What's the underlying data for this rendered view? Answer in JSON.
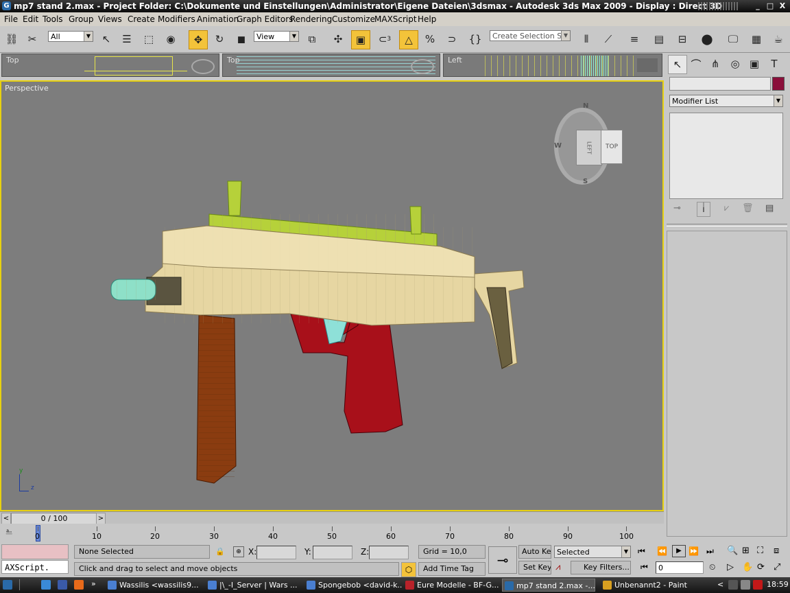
{
  "title_bar": {
    "text": "mp7 stand 2.max      - Project Folder: C:\\Dokumente und Einstellungen\\Administrator\\Eigene Dateien\\3dsmax      - Autodesk 3ds Max  2009         - Display : Direct 3D",
    "minimize": "_",
    "maximize": "□",
    "close": "X"
  },
  "menu": [
    "File",
    "Edit",
    "Tools",
    "Group",
    "Views",
    "Create",
    "Modifiers",
    "Animation",
    "Graph Editors",
    "Rendering",
    "Customize",
    "MAXScript",
    "Help"
  ],
  "toolbar": {
    "selection_filter": "All",
    "ref_coord": "View",
    "snap_count": "3",
    "named_selection_placeholder": "Create Selection Set"
  },
  "viewports": {
    "top_left_label": "Top",
    "top_mid_label": "Top",
    "left_label": "Left",
    "perspective_label": "Perspective",
    "viewcube": {
      "face_left": "LEFT",
      "face_top": "TOP",
      "compass_n": "N",
      "compass_s": "S",
      "compass_w": "W"
    },
    "axis_y": "y",
    "axis_z": "z"
  },
  "command_panel": {
    "object_name": "",
    "modifier_list": "Modifier List",
    "color_swatch": "#8a0f3a"
  },
  "timeline": {
    "frame_display": "0 / 100",
    "prev": "<",
    "next": ">",
    "ticks": [
      "0",
      "10",
      "20",
      "30",
      "40",
      "50",
      "60",
      "70",
      "80",
      "90",
      "100"
    ]
  },
  "status": {
    "maxscript": "AXScript.",
    "selection": "None Selected",
    "prompt": "Click and drag to select and move objects",
    "x_label": "X:",
    "y_label": "Y:",
    "z_label": "Z:",
    "x_value": "",
    "y_value": "",
    "z_value": "",
    "grid": "Grid = 10,0",
    "add_time_tag": "Add Time Tag",
    "auto_key": "Auto Key",
    "set_key": "Set Key",
    "selected_combo": "Selected",
    "key_filters": "Key Filters...",
    "current_frame": "0"
  },
  "taskbar": {
    "items": [
      {
        "label": "Wassilis <wassilis9...",
        "color": "#4a7fd1"
      },
      {
        "label": "|\\_-I_Server | Wars ...",
        "color": "#4a7fd1"
      },
      {
        "label": "Spongebob <david-k...",
        "color": "#4a7fd1"
      },
      {
        "label": "Eure Modelle - BF-G...",
        "color": "#b8222a"
      },
      {
        "label": "mp7 stand 2.max   -...",
        "color": "#2a6aa8"
      },
      {
        "label": "Unbenannt2 - Paint",
        "color": "#d9a020"
      }
    ],
    "clock": "18:59",
    "tray_arrow": "<"
  }
}
